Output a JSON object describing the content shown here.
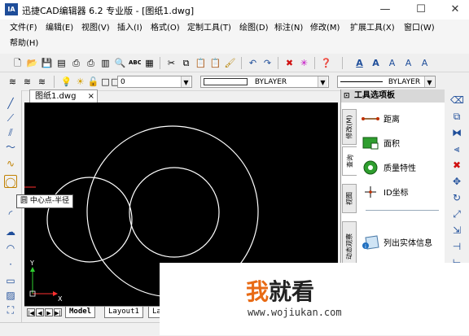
{
  "window": {
    "title": "迅捷CAD编辑器 6.2 专业版 - [图纸1.dwg]",
    "app_icon_text": "IA",
    "minimize": "—",
    "maximize": "☐",
    "close": "✕"
  },
  "menu": [
    {
      "label": "文件(F)"
    },
    {
      "label": "编辑(E)"
    },
    {
      "label": "视图(V)"
    },
    {
      "label": "插入(I)"
    },
    {
      "label": "格式(O)"
    },
    {
      "label": "定制工具(T)"
    },
    {
      "label": "绘图(D)"
    },
    {
      "label": "标注(N)"
    },
    {
      "label": "修改(M)"
    },
    {
      "label": "扩展工具(X)"
    },
    {
      "label": "窗口(W)"
    },
    {
      "label": "帮助(H)"
    }
  ],
  "layer_bar": {
    "layer_value": "0",
    "linetype_value": "BYLAYER",
    "lineweight_value": "BYLAYER"
  },
  "document_tab": {
    "label": "图纸1.dwg",
    "close": "×"
  },
  "tooltip": {
    "text": "圆 中心点-半径"
  },
  "layout_tabs": [
    {
      "label": "Model"
    },
    {
      "label": "Layout1"
    },
    {
      "label": "La"
    }
  ],
  "tool_palette": {
    "title": "工具选项板",
    "pin": "⊡",
    "vertical_tabs": [
      {
        "label": "修改(M)"
      },
      {
        "label": "查询"
      },
      {
        "label": "视图"
      },
      {
        "label": "动态观察"
      }
    ],
    "items": [
      {
        "label": "距离",
        "icon": "distance-icon"
      },
      {
        "label": "面积",
        "icon": "area-icon"
      },
      {
        "label": "质量特性",
        "icon": "mass-properties-icon"
      },
      {
        "label": "ID坐标",
        "icon": "id-point-icon"
      },
      {
        "label": "列出实体信息",
        "icon": "list-info-icon"
      }
    ]
  },
  "ucs": {
    "y": "Y",
    "x": "X"
  },
  "watermark": {
    "title_orange": "我",
    "title_rest": "就看",
    "url": "www.wojiukan.com"
  },
  "colors": {
    "canvas": "#000000",
    "accent": "#1f4e9a",
    "watermark_orange": "#e86a14"
  }
}
